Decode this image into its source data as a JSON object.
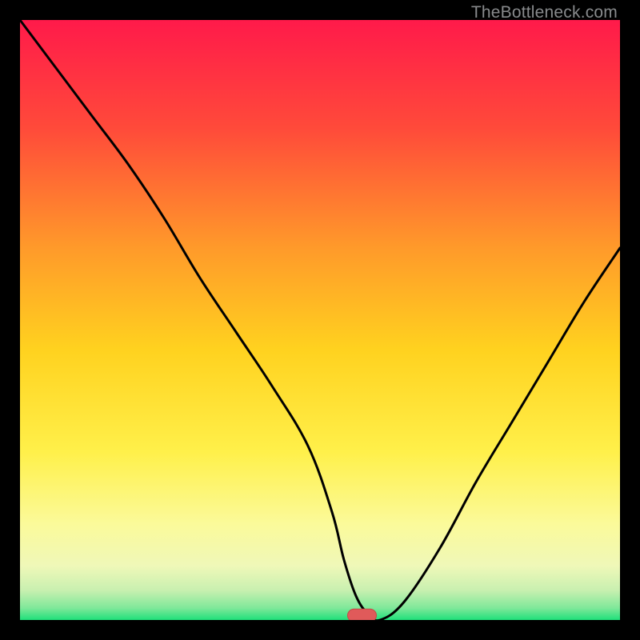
{
  "watermark": "TheBottleneck.com",
  "colors": {
    "bg": "#000000",
    "grad_top": "#ff1a4a",
    "grad_mid_upper": "#ff6a2a",
    "grad_mid": "#ffd21f",
    "grad_mid_lower": "#fff568",
    "grad_lower": "#f3fca5",
    "grad_bottom": "#1fe07a",
    "curve": "#000000",
    "marker_fill": "#e05a5a",
    "marker_stroke": "#c74848"
  },
  "chart_data": {
    "type": "line",
    "title": "",
    "xlabel": "",
    "ylabel": "",
    "xlim": [
      0,
      100
    ],
    "ylim": [
      0,
      100
    ],
    "series": [
      {
        "name": "bottleneck-curve",
        "x": [
          0,
          6,
          12,
          18,
          24,
          30,
          36,
          42,
          48,
          52,
          54,
          56,
          58,
          60,
          64,
          70,
          76,
          82,
          88,
          94,
          100
        ],
        "y": [
          100,
          92,
          84,
          76,
          67,
          57,
          48,
          39,
          29,
          18,
          10,
          4,
          1,
          0,
          3,
          12,
          23,
          33,
          43,
          53,
          62
        ]
      }
    ],
    "optimum_marker": {
      "x": 57,
      "y": 0.5
    },
    "annotations": [
      "TheBottleneck.com"
    ]
  }
}
